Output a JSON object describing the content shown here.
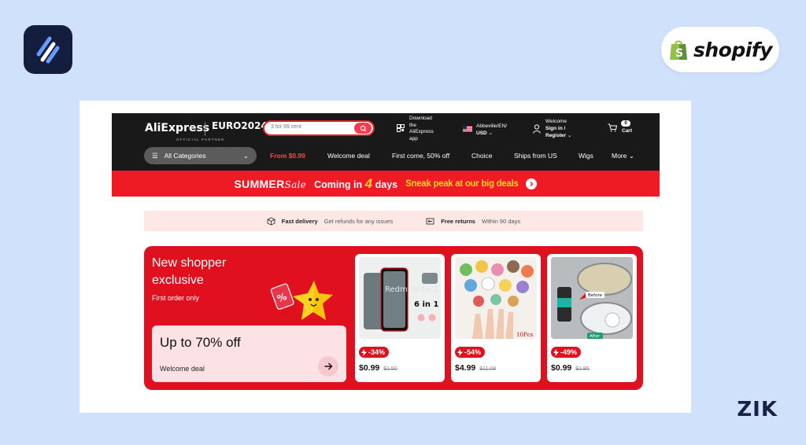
{
  "brand": {
    "overlay_logo": "ZIK",
    "shopify_text": "shopify"
  },
  "header": {
    "logo_text": "AliExpress",
    "euro_text": "EURO2024",
    "partner_text": "OFFICIAL PARTNER",
    "search_placeholder": "3 for 99 cent",
    "download": [
      "Download",
      "the",
      "AliExpress",
      "app"
    ],
    "locale": {
      "line1": "Abbeville/EN/",
      "line2": "USD"
    },
    "account": {
      "line1": "Welcome",
      "line2": "Sign in /",
      "line3": "Register"
    },
    "cart": {
      "count": "0",
      "label": "Cart"
    }
  },
  "nav": {
    "all_categories": "All Categories",
    "items": [
      "From $0.99",
      "Welcome deal",
      "First come, 50% off",
      "Choice",
      "Ships from US",
      "Wigs",
      "More"
    ]
  },
  "promo": {
    "summer": "SUMMER",
    "sale": "Sale",
    "coming_prefix": "Coming in",
    "days_num": "4",
    "days_word": "days",
    "sneak": "Sneak peak at our big deals"
  },
  "benefits": {
    "fast_title": "Fast delivery",
    "fast_desc": "Get refunds for any issues",
    "returns_title": "Free returns",
    "returns_desc": "Within 90 days"
  },
  "deal": {
    "title_line1": "New shopper",
    "title_line2": "exclusive",
    "subtitle": "First order only",
    "box_title": "Up to 70% off",
    "box_sub": "Welcome deal"
  },
  "products": [
    {
      "discount": "-34%",
      "price": "$0.99",
      "original": "$1.50",
      "img_text": "Redmi Note 13",
      "img_badge": "6 in 1"
    },
    {
      "discount": "-54%",
      "price": "$4.99",
      "original": "$11.08",
      "img_badge": "10Pcs"
    },
    {
      "discount": "-49%",
      "price": "$0.99",
      "original": "$1.95",
      "img_label_top": "Before",
      "img_label_bottom": "After"
    }
  ],
  "colors": {
    "accent": "#ee1a24",
    "dark": "#191919",
    "background": "#cfe1fb",
    "highlight": "#ffd61f"
  }
}
